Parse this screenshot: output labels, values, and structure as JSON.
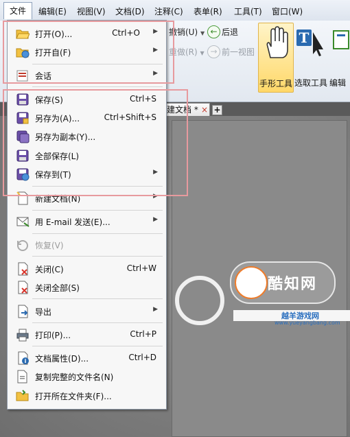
{
  "menubar": {
    "items": [
      "文件",
      "编辑(E)",
      "视图(V)",
      "文档(D)",
      "注释(C)",
      "表单(R)",
      "工具(T)",
      "窗口(W)"
    ]
  },
  "ribbon": {
    "undo_label": "撤销(U)",
    "back_label": "后退",
    "redo_label": "重做(R)",
    "prev_view_label": "前一视图",
    "tools": [
      "手形工具",
      "选取工具",
      "编辑"
    ]
  },
  "tabs": {
    "doc_tab_label": "建文档 *",
    "close_glyph": "×",
    "new_tab_glyph": "+"
  },
  "file_menu": {
    "items": [
      {
        "label": "打开(O)...",
        "shortcut": "Ctrl+O",
        "arrow": true,
        "icon": "open-folder-icon"
      },
      {
        "label": "打开自(F)",
        "shortcut": "",
        "arrow": true,
        "icon": "open-from-icon"
      },
      {
        "label": "会话",
        "shortcut": "",
        "arrow": true,
        "icon": "session-icon"
      },
      {
        "label": "保存(S)",
        "shortcut": "Ctrl+S",
        "arrow": false,
        "icon": "save-icon"
      },
      {
        "label": "另存为(A)...",
        "shortcut": "Ctrl+Shift+S",
        "arrow": false,
        "icon": "save-as-icon"
      },
      {
        "label": "另存为副本(Y)...",
        "shortcut": "",
        "arrow": false,
        "icon": "save-copy-icon"
      },
      {
        "label": "全部保存(L)",
        "shortcut": "",
        "arrow": false,
        "icon": "save-all-icon"
      },
      {
        "label": "保存到(T)",
        "shortcut": "",
        "arrow": true,
        "icon": "save-to-icon"
      },
      {
        "label": "新建文档(N)",
        "shortcut": "",
        "arrow": true,
        "icon": "new-document-icon"
      },
      {
        "label": "用 E-mail 发送(E)...",
        "shortcut": "",
        "arrow": true,
        "icon": "email-icon"
      },
      {
        "label": "恢复(V)",
        "shortcut": "",
        "arrow": false,
        "icon": "revert-icon",
        "disabled": true
      },
      {
        "label": "关闭(C)",
        "shortcut": "Ctrl+W",
        "arrow": false,
        "icon": "close-doc-icon"
      },
      {
        "label": "关闭全部(S)",
        "shortcut": "",
        "arrow": false,
        "icon": "close-all-icon"
      },
      {
        "label": "导出",
        "shortcut": "",
        "arrow": true,
        "icon": "export-icon"
      },
      {
        "label": "打印(P)...",
        "shortcut": "Ctrl+P",
        "arrow": false,
        "icon": "print-icon"
      },
      {
        "label": "文档属性(D)...",
        "shortcut": "Ctrl+D",
        "arrow": false,
        "icon": "properties-icon"
      },
      {
        "label": "复制完整的文件名(N)",
        "shortcut": "",
        "arrow": false,
        "icon": "copy-filename-icon"
      },
      {
        "label": "打开所在文件夹(F)...",
        "shortcut": "",
        "arrow": false,
        "icon": "open-folder-location-icon"
      }
    ]
  },
  "watermark": {
    "brand_text": "酷知网",
    "site_text": "越羊游戏网",
    "url_text": "www.yueyangbang.com"
  },
  "colors": {
    "highlight_box": "#e79a9e",
    "menu_bg": "#f7f7f7",
    "hand_tool_active": "#ffd869"
  }
}
